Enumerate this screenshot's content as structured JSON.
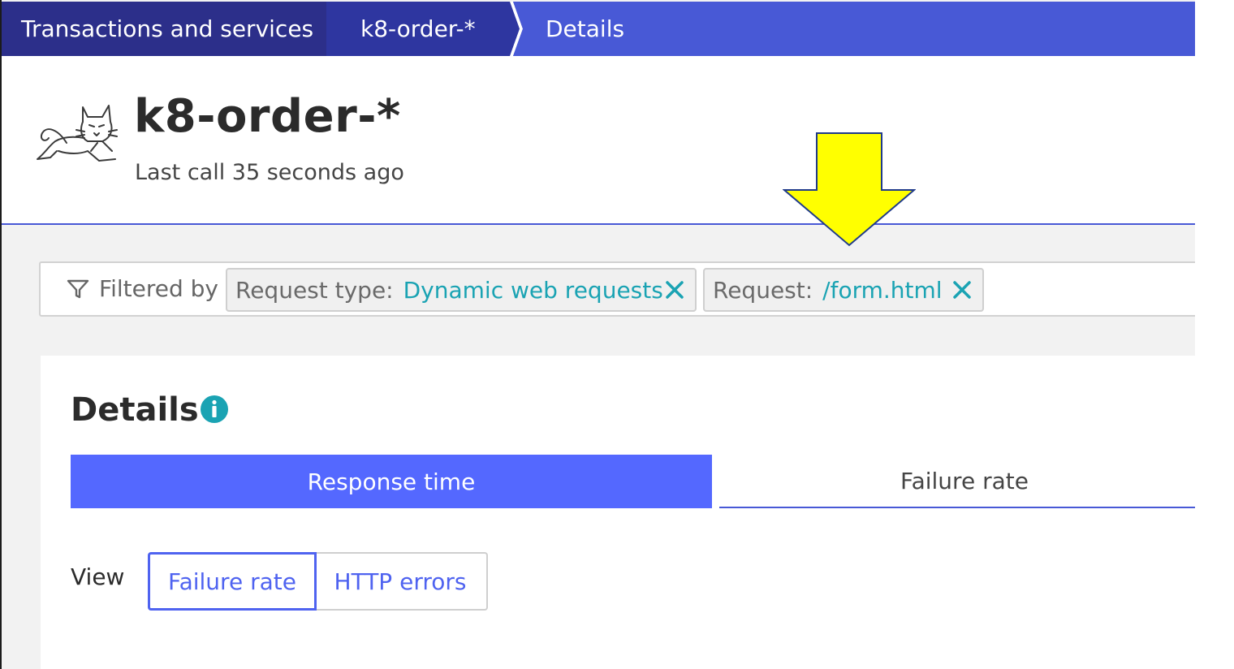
{
  "breadcrumb": {
    "items": [
      {
        "label": "Transactions and services"
      },
      {
        "label": "k8-order-*"
      },
      {
        "label": "Details"
      }
    ]
  },
  "header": {
    "title": "k8-order-*",
    "subtitle": "Last call 35 seconds ago",
    "icon": "tomcat-icon"
  },
  "filter": {
    "label": "Filtered by",
    "chips": [
      {
        "key": "Request type:",
        "value": "Dynamic web requests"
      },
      {
        "key": "Request:",
        "value": "/form.html"
      }
    ]
  },
  "details": {
    "title": "Details",
    "tabs": [
      {
        "label": "Response time",
        "active": true
      },
      {
        "label": "Failure rate",
        "active": false
      }
    ],
    "view": {
      "label": "View",
      "options": [
        {
          "label": "Failure rate",
          "selected": true
        },
        {
          "label": "HTTP errors",
          "selected": false
        }
      ]
    }
  },
  "colors": {
    "breadcrumb": "#4859d6",
    "accent": "#5468ff",
    "chip_value": "#1aa3b3",
    "annotation_arrow": "#ffff00"
  }
}
